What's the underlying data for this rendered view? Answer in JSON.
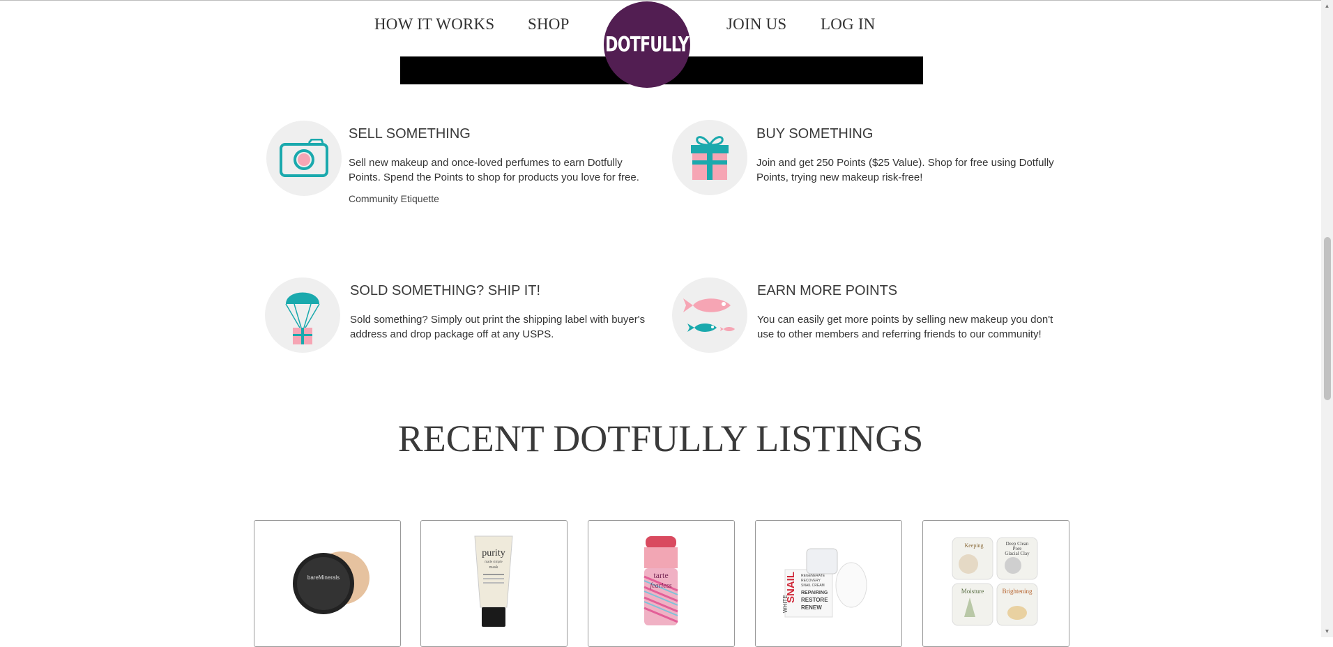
{
  "nav": {
    "how_it_works": "HOW IT WORKS",
    "shop": "SHOP",
    "join_us": "JOIN US",
    "log_in": "LOG IN",
    "logo": "DOTFULLY"
  },
  "features": [
    {
      "title": "SELL SOMETHING",
      "desc_line1": "Sell new makeup and once-loved perfumes to earn Dotfully",
      "desc_line2": "Points. Spend the Points to shop for products you love for free.",
      "link": "Community Etiquette",
      "icon": "camera-icon"
    },
    {
      "title": "BUY SOMETHING",
      "desc_line1": "Join and get 250 Points ($25 Value). Shop for free using Dotfully",
      "desc_line2": "Points, trying new makeup risk-free!",
      "icon": "gift-icon"
    },
    {
      "title": "SOLD SOMETHING? SHIP IT!",
      "desc_line1": "Sold something? Simply out print the shipping label with buyer's",
      "desc_line2": "address and drop package off at any USPS.",
      "icon": "parachute-gift-icon"
    },
    {
      "title": "EARN MORE POINTS",
      "desc_line1": "You can easily get more points by selling new makeup you don't",
      "desc_line2": "use to other members and referring friends to our community!",
      "icon": "fish-icon"
    }
  ],
  "listings": {
    "heading": "RECENT DOTFULLY LISTINGS",
    "items": [
      {
        "product_text": "bareMinerals"
      },
      {
        "product_text_1": "purity",
        "product_text_2": "made simple",
        "product_text_3": "mask"
      },
      {
        "product_text_1": "tarte",
        "product_text_2": "fearless"
      },
      {
        "product_text_1": "SNAIL",
        "product_text_2": "WHITE",
        "product_text_3": "REGENERATE",
        "product_text_4": "RECOVERY",
        "product_text_5": "SNAIL CREAM",
        "product_text_6": "REPAIRING",
        "product_text_7": "RESTORE",
        "product_text_8": "RENEW"
      },
      {
        "product_text_1": "Keeping",
        "product_text_2": "Deep Clean",
        "product_text_3": "Pore",
        "product_text_4": "Glacial Clay",
        "product_text_5": "Moisture",
        "product_text_6": "Brightening"
      }
    ]
  },
  "colors": {
    "brand": "#521e52",
    "teal": "#1aa9ad",
    "pink": "#f6a5b4"
  }
}
